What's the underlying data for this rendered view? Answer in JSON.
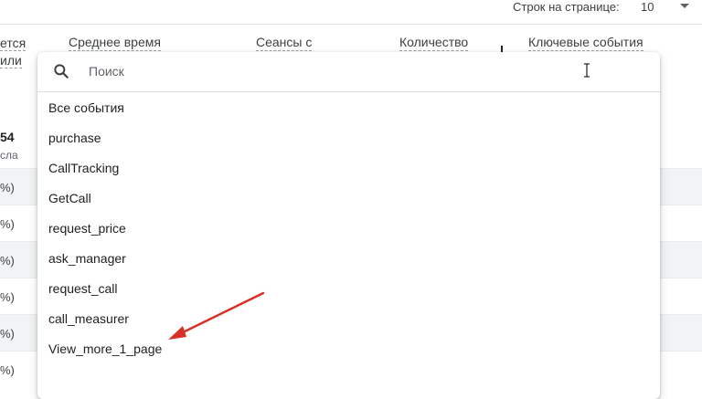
{
  "pagination": {
    "rows_label": "Строк на странице:",
    "rows_value": "10"
  },
  "table": {
    "left_header_line1": "ется",
    "left_header_line2": "или",
    "columns": [
      "Среднее время",
      "Сеансы с",
      "Количество",
      "Ключевые события"
    ],
    "total_value": "54",
    "total_sub": "сла",
    "row_cells": [
      "%)",
      "%)",
      "%)",
      "%)",
      "%)",
      "%)"
    ]
  },
  "dropdown": {
    "search_placeholder": "Поиск",
    "items": [
      "Все события",
      "purchase",
      "CallTracking",
      "GetCall",
      "request_price",
      "ask_manager",
      "request_call",
      "call_measurer",
      "View_more_1_page"
    ]
  },
  "colors": {
    "annotation_arrow": "#d93025"
  }
}
